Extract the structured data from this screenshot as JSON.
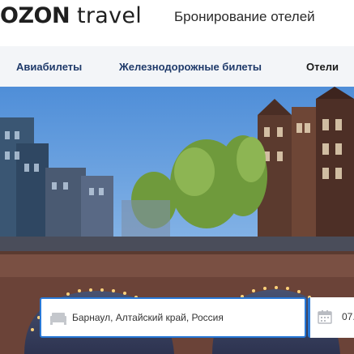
{
  "header": {
    "logo_brand": "OZON",
    "logo_sub": " travel",
    "title": "Бронирование отелей"
  },
  "nav": {
    "items": [
      {
        "label": "Авиабилеты",
        "active": false
      },
      {
        "label": "Железнодорожные билеты",
        "active": false
      },
      {
        "label": "Отели",
        "active": true
      }
    ]
  },
  "search": {
    "destination_value": "Барнаул, Алтайский край, Россия",
    "destination_icon": "bed-icon",
    "date_icon": "calendar-icon",
    "date_value": "07."
  },
  "colors": {
    "accent": "#2878d6",
    "nav_text": "#1f3a6a",
    "nav_bg": "#f3f5f8"
  }
}
